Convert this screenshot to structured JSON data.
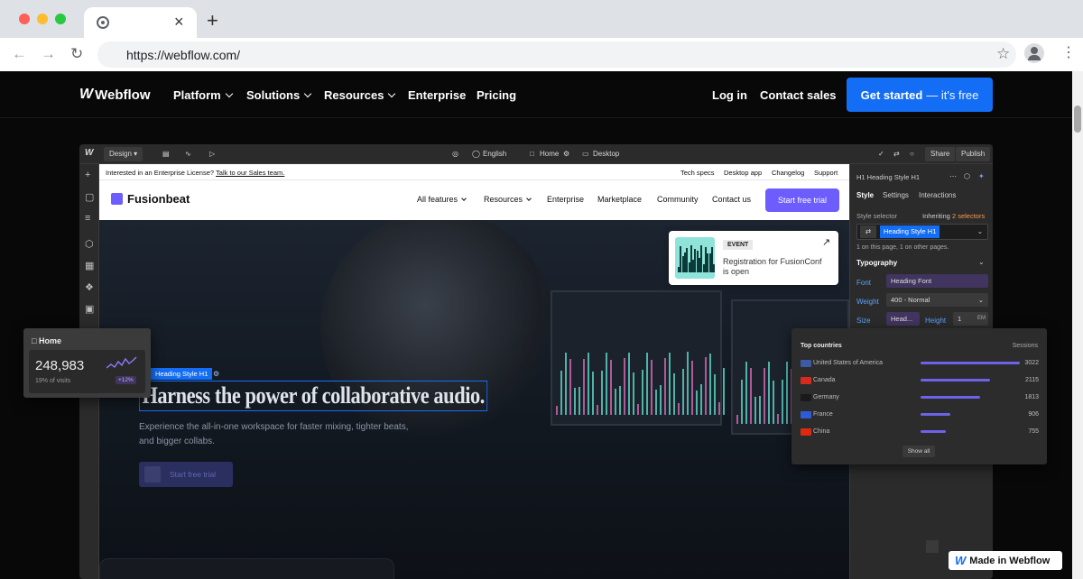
{
  "browser": {
    "url": "https://webflow.com/",
    "tab_close": "×",
    "new_tab": "+"
  },
  "webflow_nav": {
    "logo": "Webflow",
    "items": [
      "Platform",
      "Solutions",
      "Resources",
      "Enterprise",
      "Pricing"
    ],
    "login": "Log in",
    "contact": "Contact sales",
    "cta_main": "Get started",
    "cta_rest": "— it's free"
  },
  "designer": {
    "mode": "Design",
    "locale": "English",
    "page": "Home",
    "breakpoint": "Desktop",
    "share": "Share",
    "publish": "Publish"
  },
  "site": {
    "notice_text": "Interested in an Enterprise License?",
    "notice_link": "Talk to our Sales team.",
    "notice_links": [
      "Tech specs",
      "Desktop app",
      "Changelog",
      "Support"
    ],
    "logo": "Fusionbeat",
    "nav": [
      "All features",
      "Resources",
      "Enterprise",
      "Marketplace",
      "Community",
      "Contact us"
    ],
    "cta": "Start free trial",
    "event_tag": "EVENT",
    "event_title": "Registration for FusionConf is open",
    "selected_tag": "Heading Style H1",
    "headline": "Harness the power of collaborative audio.",
    "subtext": "Experience the all-in-one workspace for faster mixing, tighter beats, and bigger collabs.",
    "hero_button": "Start free trial"
  },
  "style_panel": {
    "element": "H1 Heading Style H1",
    "tabs": [
      "Style",
      "Settings",
      "Interactions"
    ],
    "selector_label": "Style selector",
    "inheriting": "Inheriting",
    "inheriting_count": "2 selectors",
    "selector_value": "Heading Style H1",
    "usage": "1 on this page, 1 on other pages.",
    "typography": "Typography",
    "font_label": "Font",
    "font_value": "Heading Font",
    "weight_label": "Weight",
    "weight_value": "400 - Normal",
    "size_label": "Size",
    "size_value": "Head...",
    "height_label": "Height",
    "height_value": "1",
    "height_unit": "EM"
  },
  "home_card": {
    "title": "Home",
    "value": "248,983",
    "subtitle": "19% of visits",
    "badge": "+12%"
  },
  "countries_card": {
    "title": "Top countries",
    "column": "Sessions",
    "rows": [
      {
        "name": "United States of America",
        "value": "3022",
        "share": 1.0,
        "flag": "#3c5aa6"
      },
      {
        "name": "Canada",
        "value": "2115",
        "share": 0.7,
        "flag": "#d52b1e"
      },
      {
        "name": "Germany",
        "value": "1813",
        "share": 0.6,
        "flag": "#1a1a1a"
      },
      {
        "name": "France",
        "value": "906",
        "share": 0.3,
        "flag": "#2e5bd6"
      },
      {
        "name": "China",
        "value": "755",
        "share": 0.25,
        "flag": "#de2910"
      }
    ],
    "show_all": "Show all"
  },
  "badge": {
    "label": "Made in Webflow"
  }
}
